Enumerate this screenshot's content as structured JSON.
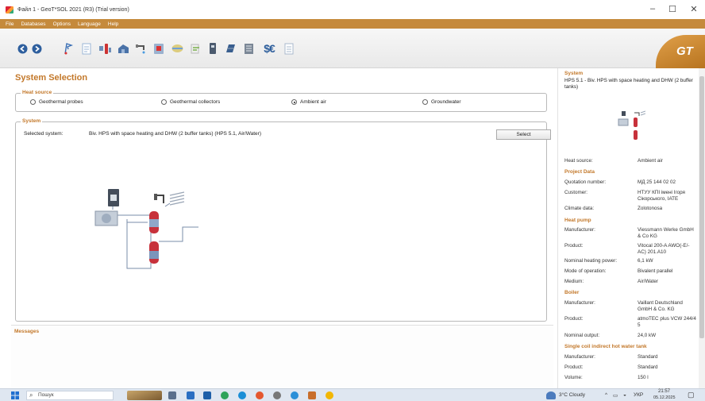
{
  "window": {
    "title": "Файл 1 - GeoT*SOL 2021 (R3) (Trial version)",
    "minimize": "–",
    "maximize": "☐",
    "close": "✕"
  },
  "menu": [
    "File",
    "Databases",
    "Options",
    "Language",
    "Help"
  ],
  "logo": "GT",
  "main": {
    "title": "System Selection",
    "heat_source": {
      "legend": "Heat source",
      "options": [
        "Geothermal probes",
        "Geothermal collectors",
        "Ambient air",
        "Groundwater"
      ],
      "selected": "Ambient air"
    },
    "system": {
      "legend": "System",
      "selected_label": "Selected system:",
      "selected_value": "Biv. HPS with space heating and DHW (2 buffer tanks) (HPS 5.1, Air/Water)",
      "select_button": "Select"
    }
  },
  "messages": {
    "label": "Messages"
  },
  "right_panel": {
    "system_heading": "System",
    "system_text": "HPS 5.1 - Biv. HPS with space heating and DHW (2 buffer tanks)",
    "heat_source": {
      "k": "Heat source:",
      "v": "Ambient air"
    },
    "project_heading": "Project Data",
    "quotation": {
      "k": "Quotation number:",
      "v": "МД 25 144 02 02"
    },
    "customer": {
      "k": "Customer:",
      "v": "НТУУ КПІ імені Ігоря Сікорського, ІАТЕ"
    },
    "climate": {
      "k": "Climate data:",
      "v": "Zolotonosa"
    },
    "heatpump_heading": "Heat pump",
    "hp_manufacturer": {
      "k": "Manufacturer:",
      "v": "Viessmann Werke GmbH & Co KG"
    },
    "hp_product": {
      "k": "Product:",
      "v": "Vitocal 200-A AWO(-E/-AC) 201.A10"
    },
    "hp_power": {
      "k": "Nominal heating power:",
      "v": "6,1 kW"
    },
    "hp_mode": {
      "k": "Mode of operation:",
      "v": "Bivalent parallel"
    },
    "hp_medium": {
      "k": "Medium:",
      "v": "Air/Water"
    },
    "boiler_heading": "Boiler",
    "b_manufacturer": {
      "k": "Manufacturer:",
      "v": "Vaillant Deutschland GmbH & Co. KG"
    },
    "b_product": {
      "k": "Product:",
      "v": "atmoTEC plus VCW 244/4 5"
    },
    "b_output": {
      "k": "Nominal output:",
      "v": "24,0 kW"
    },
    "tank_heading": "Single coil indirect hot water tank",
    "t_manufacturer": {
      "k": "Manufacturer:",
      "v": "Standard"
    },
    "t_product": {
      "k": "Product:",
      "v": "Standard"
    },
    "t_volume": {
      "k": "Volume:",
      "v": "150 l"
    }
  },
  "taskbar": {
    "search_placeholder": "Пошук",
    "weather": "3°C Cloudy",
    "language": "УКР",
    "time": "21:57",
    "date": "05.12.2025"
  },
  "colors": {
    "accent": "#c3782a",
    "menubar": "#c58a3c"
  }
}
